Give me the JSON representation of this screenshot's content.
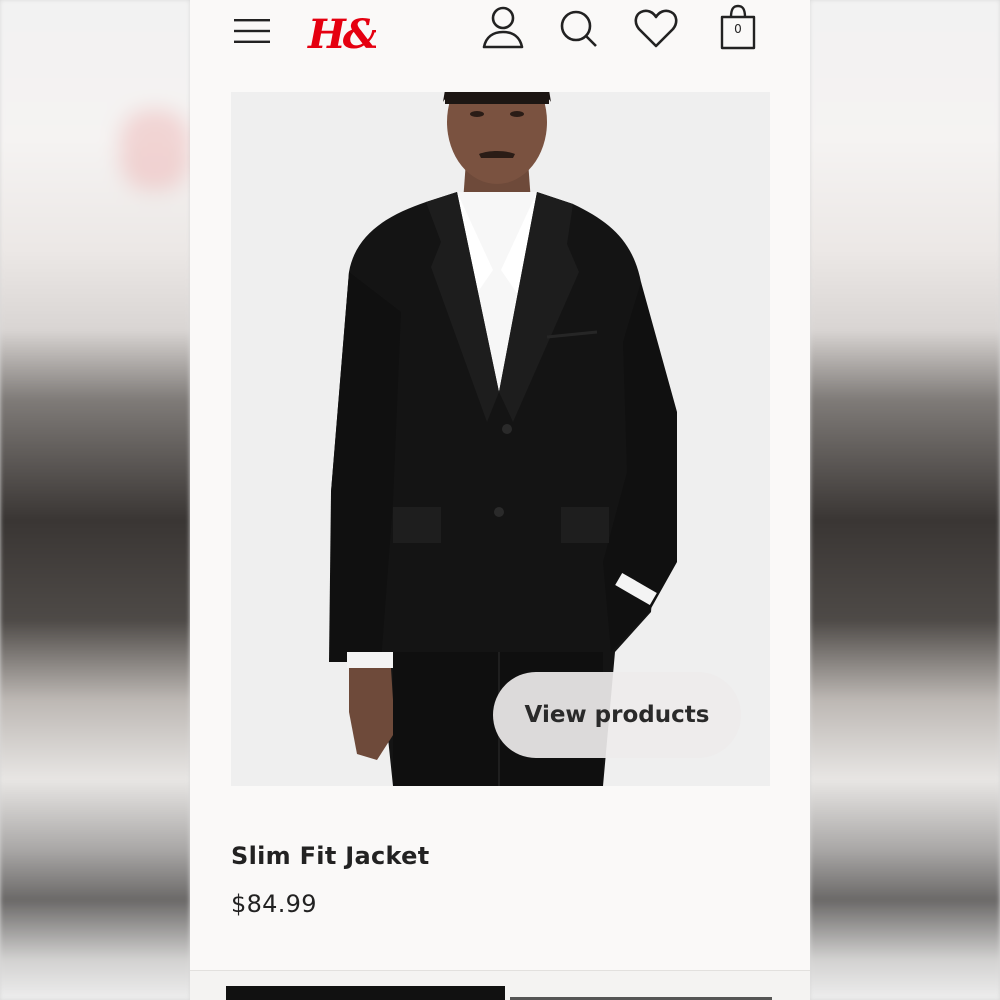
{
  "header": {
    "logo_text": "H&M",
    "bag_count": "0"
  },
  "icons": {
    "menu": "hamburger-menu-icon",
    "account": "account-icon",
    "search": "search-icon",
    "favorites": "heart-icon",
    "bag": "shopping-bag-icon"
  },
  "product": {
    "image_alt": "Man wearing black slim fit suit jacket with white shirt",
    "view_button_label": "View products",
    "name": "Slim Fit Jacket",
    "price": "$84.99"
  },
  "colors": {
    "brand_red": "#e50010",
    "text": "#222222",
    "background": "#faf9f8"
  }
}
